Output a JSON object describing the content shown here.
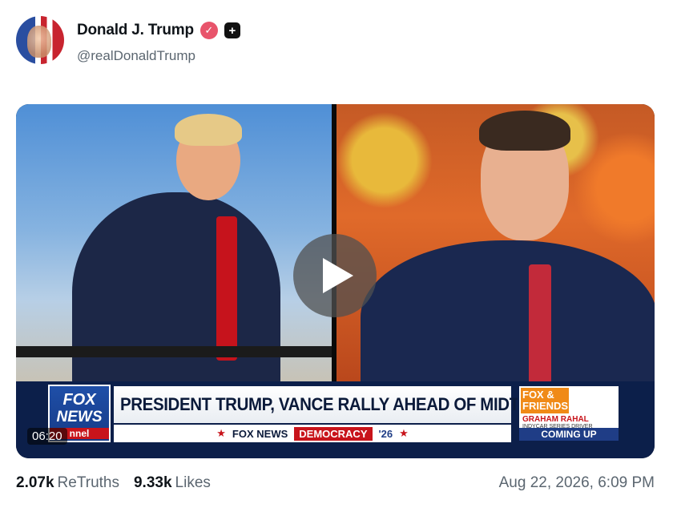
{
  "post": {
    "display_name": "Donald J. Trump",
    "handle": "@realDonaldTrump",
    "verified_icon": "verified-badge-icon",
    "plus_icon": "plus-icon",
    "date": "Aug 22, 2026, 6:09 PM"
  },
  "media": {
    "type": "video",
    "timestamp": "06:20",
    "chyron": {
      "network_logo_top": "FOX",
      "network_logo_bottom": "NEWS",
      "network_logo_channel": "nnel",
      "headline": "PRESIDENT TRUMP, VANCE RALLY AHEAD OF MIDTERMS",
      "ticker_brand": "FOX NEWS",
      "ticker_segment": "DEMOCRACY",
      "ticker_year": "'26",
      "promo_show": "FOX & FRIENDS",
      "promo_guest": "GRAHAM RAHAL",
      "promo_guest_title": "INDYCAR SERIES DRIVER",
      "promo_status": "COMING UP"
    }
  },
  "stats": {
    "retruths_count": "2.07k",
    "retruths_label": "ReTruths",
    "likes_count": "9.33k",
    "likes_label": "Likes"
  }
}
